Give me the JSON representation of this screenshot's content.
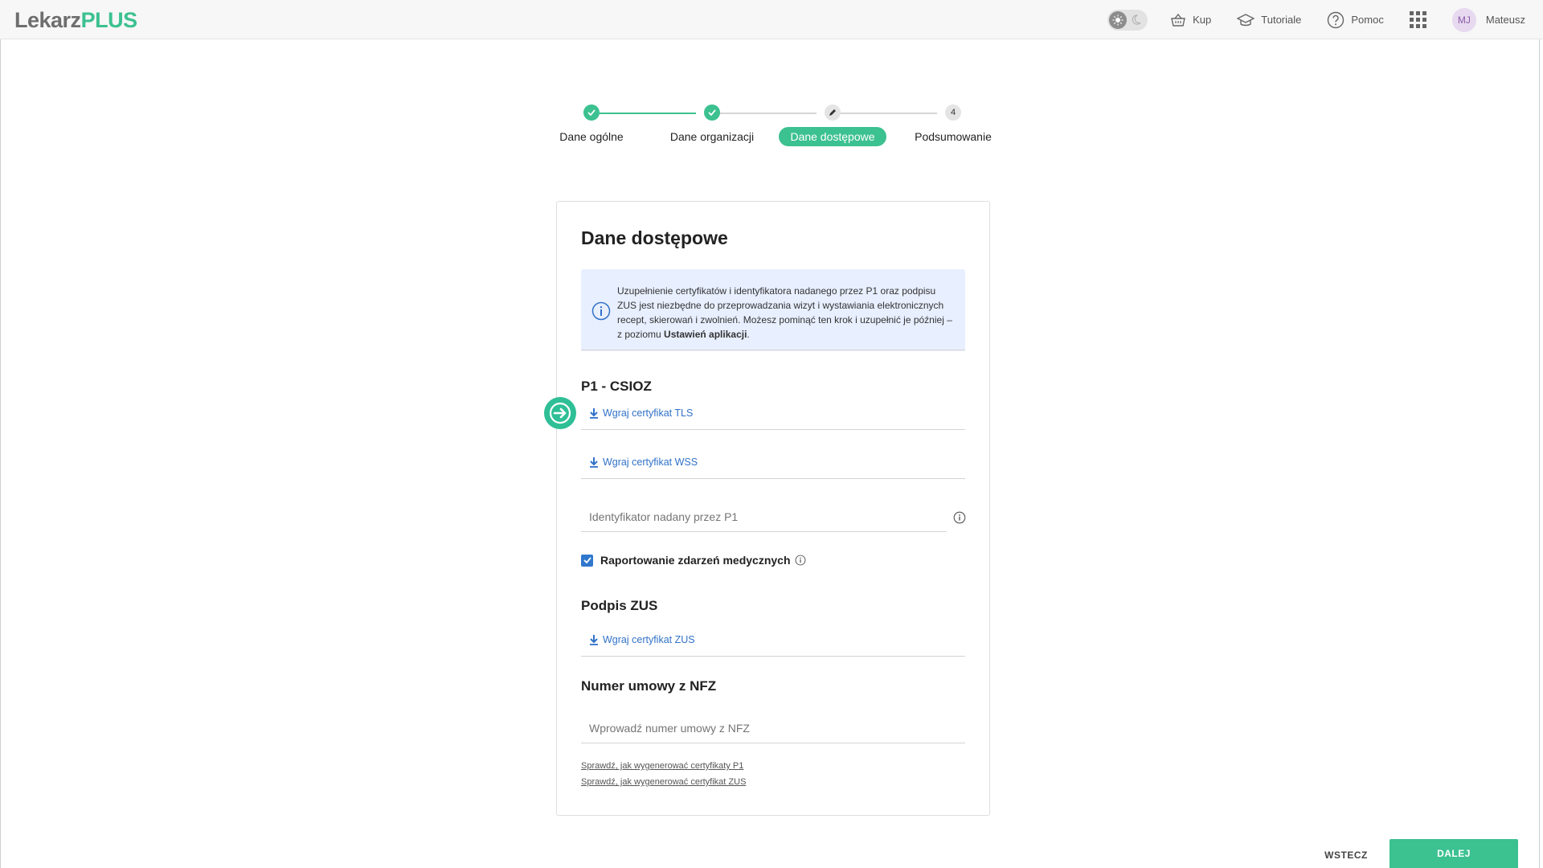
{
  "app": {
    "logo_part1": "Lekarz",
    "logo_part2": "PLUS"
  },
  "nav": {
    "buy": "Kup",
    "tutorials": "Tutoriale",
    "help": "Pomoc",
    "avatar_initials": "MJ",
    "user_name": "Mateusz"
  },
  "stepper": {
    "steps": [
      {
        "label": "Dane ogólne",
        "state": "done",
        "marker": ""
      },
      {
        "label": "Dane organizacji",
        "state": "done",
        "marker": ""
      },
      {
        "label": "Dane dostępowe",
        "state": "active",
        "marker": ""
      },
      {
        "label": "Podsumowanie",
        "state": "pending",
        "marker": "4"
      }
    ]
  },
  "card": {
    "title": "Dane dostępowe",
    "info_text_main": "Uzupełnienie certyfikatów i identyfikatora nadanego przez P1 oraz podpisu ZUS jest niezbędne do przeprowadzania wizyt i wystawiania elektronicznych recept, skierowań i zwolnień. Możesz pominąć ten krok i uzupełnić je później – z poziomu ",
    "info_text_bold": "Ustawień aplikacji",
    "info_text_end": ".",
    "p1_title": "P1 - CSIOZ",
    "upload_tls": "Wgraj certyfikat TLS",
    "upload_wss": "Wgraj certyfikat WSS",
    "p1_id_placeholder": "Identyfikator nadany przez P1",
    "reporting_label": "Raportowanie zdarzeń medycznych",
    "reporting_checked": true,
    "zus_title": "Podpis ZUS",
    "upload_zus": "Wgraj certyfikat ZUS",
    "nfz_title": "Numer umowy z NFZ",
    "nfz_placeholder": "Wprowadź numer umowy z NFZ",
    "help_p1": "Sprawdź, jak wygenerować certyfikaty P1",
    "help_zus": "Sprawdź, jak wygenerować certyfikat ZUS"
  },
  "footer": {
    "back": "WSTECZ",
    "next": "DALEJ"
  },
  "colors": {
    "brand_green": "#3cc190",
    "link_blue": "#3172c8",
    "info_bg": "#e8efff"
  }
}
